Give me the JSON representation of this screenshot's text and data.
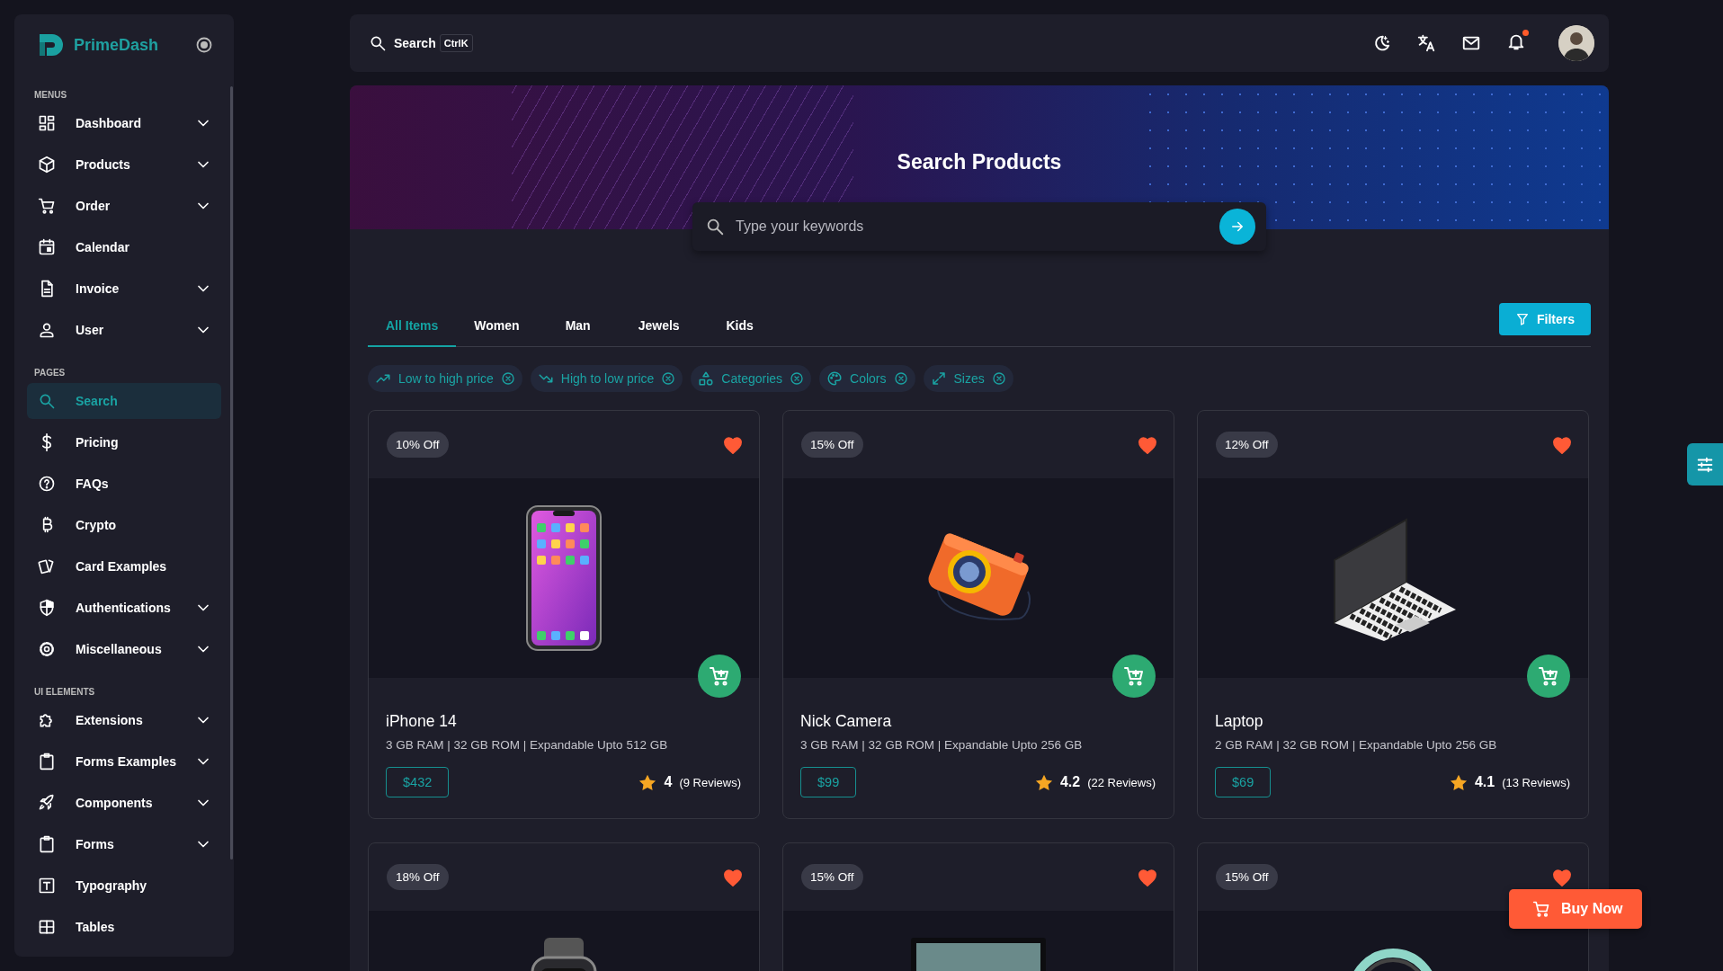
{
  "sidebar": {
    "brand": "PrimeDash",
    "sections": [
      {
        "title": "MENUS",
        "items": [
          {
            "label": "Dashboard",
            "kind": "group",
            "selected": false
          },
          {
            "label": "Products",
            "kind": "group",
            "selected": false
          },
          {
            "label": "Order",
            "kind": "group",
            "selected": false
          },
          {
            "label": "Calendar",
            "kind": "link",
            "selected": false
          },
          {
            "label": "Invoice",
            "kind": "group",
            "selected": false
          },
          {
            "label": "User",
            "kind": "group",
            "selected": false
          }
        ]
      },
      {
        "title": "PAGES",
        "items": [
          {
            "label": "Search",
            "kind": "link",
            "selected": true
          },
          {
            "label": "Pricing",
            "kind": "link",
            "selected": false
          },
          {
            "label": "FAQs",
            "kind": "link",
            "selected": false
          },
          {
            "label": "Crypto",
            "kind": "link",
            "selected": false
          },
          {
            "label": "Card Examples",
            "kind": "link",
            "selected": false
          },
          {
            "label": "Authentications",
            "kind": "group",
            "selected": false
          },
          {
            "label": "Miscellaneous",
            "kind": "group",
            "selected": false
          }
        ]
      },
      {
        "title": "UI ELEMENTS",
        "items": [
          {
            "label": "Extensions",
            "kind": "group",
            "selected": false
          },
          {
            "label": "Forms Examples",
            "kind": "group",
            "selected": false
          },
          {
            "label": "Components",
            "kind": "group",
            "selected": false
          },
          {
            "label": "Forms",
            "kind": "group",
            "selected": false
          },
          {
            "label": "Typography",
            "kind": "link",
            "selected": false
          },
          {
            "label": "Tables",
            "kind": "link",
            "selected": false
          }
        ]
      }
    ]
  },
  "topbar": {
    "search_label": "Search",
    "shortcut": "CtrlK",
    "notification_dot": true
  },
  "hero": {
    "title": "Search Products",
    "search": {
      "placeholder": "Type your keywords"
    }
  },
  "tabs": [
    {
      "label": "All Items",
      "selected": true
    },
    {
      "label": "Women",
      "selected": false
    },
    {
      "label": "Man",
      "selected": false
    },
    {
      "label": "Jewels",
      "selected": false
    },
    {
      "label": "Kids",
      "selected": false
    }
  ],
  "filters_button": "Filters",
  "chips": [
    {
      "label": "Low to high price"
    },
    {
      "label": "High to low price"
    },
    {
      "label": "Categories"
    },
    {
      "label": "Colors"
    },
    {
      "label": "Sizes"
    }
  ],
  "products": [
    {
      "kind": "phone",
      "discount": "10% Off",
      "favorite": true,
      "name": "iPhone 14",
      "specs": "3 GB RAM | 32 GB ROM | Expandable Upto 512 GB",
      "price": "$432",
      "rating": "4",
      "reviews": "(9 Reviews)"
    },
    {
      "kind": "camera",
      "discount": "15% Off",
      "favorite": true,
      "name": "Nick Camera",
      "specs": "3 GB RAM | 32 GB ROM | Expandable Upto 256 GB",
      "price": "$99",
      "rating": "4.2",
      "reviews": "(22 Reviews)"
    },
    {
      "kind": "laptop",
      "discount": "12% Off",
      "favorite": true,
      "name": "Laptop",
      "specs": "2 GB RAM | 32 GB ROM | Expandable Upto 256 GB",
      "price": "$69",
      "rating": "4.1",
      "reviews": "(13 Reviews)"
    },
    {
      "kind": "watch",
      "discount": "18% Off",
      "favorite": true
    },
    {
      "kind": "monitor",
      "discount": "15% Off",
      "favorite": true
    },
    {
      "kind": "headphones",
      "discount": "15% Off",
      "favorite": true
    }
  ],
  "buy_now": "Buy Now"
}
